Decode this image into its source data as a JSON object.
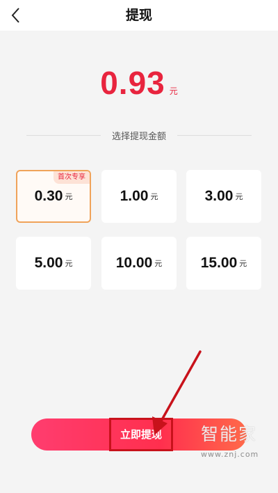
{
  "header": {
    "title": "提现"
  },
  "balance": {
    "value": "0.93",
    "unit": "元"
  },
  "section": {
    "label": "选择提现金额"
  },
  "options": [
    {
      "amount": "0.30",
      "unit": "元",
      "tag": "首次专享",
      "selected": true
    },
    {
      "amount": "1.00",
      "unit": "元"
    },
    {
      "amount": "3.00",
      "unit": "元"
    },
    {
      "amount": "5.00",
      "unit": "元"
    },
    {
      "amount": "10.00",
      "unit": "元"
    },
    {
      "amount": "15.00",
      "unit": "元"
    }
  ],
  "action": {
    "label": "立即提现"
  },
  "watermark": {
    "brand": "智能家",
    "url": "www.znj.com"
  },
  "colors": {
    "accent": "#e8243e",
    "selected_border": "#f0a35a",
    "highlight": "#c8121b"
  },
  "icons": {
    "back": "chevron-left-icon",
    "annotation": "red-arrow-icon"
  }
}
